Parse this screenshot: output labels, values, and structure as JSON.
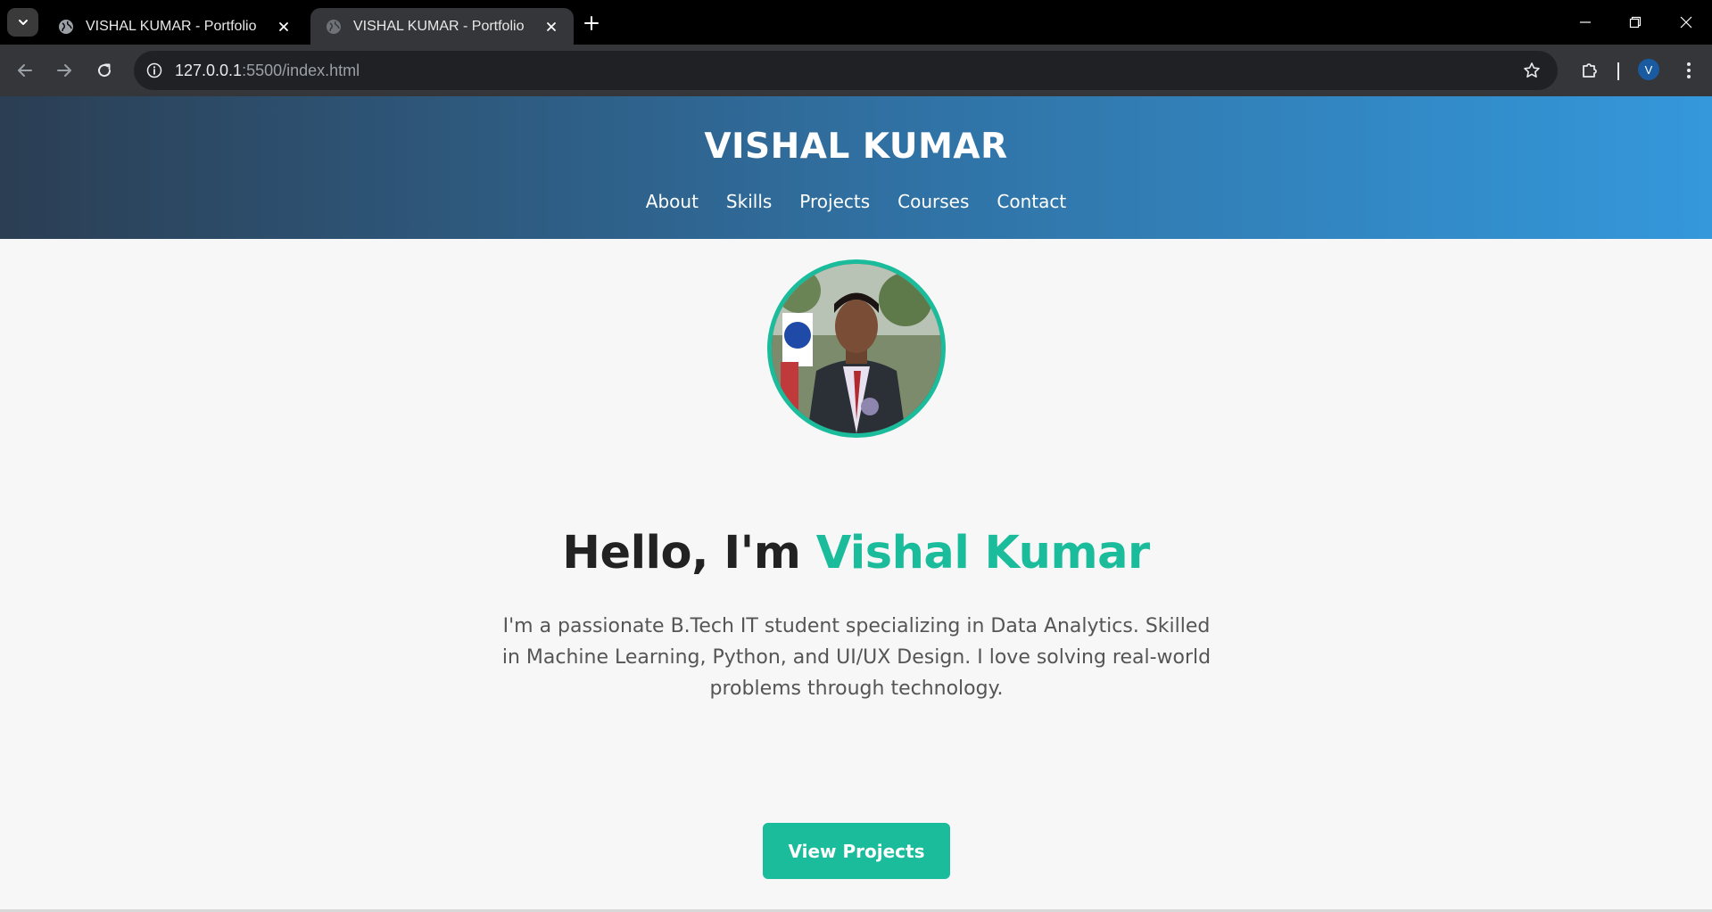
{
  "browser": {
    "tabs": [
      {
        "title": "VISHAL KUMAR - Portfolio",
        "active": false
      },
      {
        "title": "VISHAL KUMAR - Portfolio",
        "active": true
      }
    ],
    "url_host": "127.0.0.1",
    "url_rest": ":5500/index.html",
    "profile_initial": "V"
  },
  "header": {
    "title": "VISHAL KUMAR",
    "nav": [
      "About",
      "Skills",
      "Projects",
      "Courses",
      "Contact"
    ]
  },
  "hero": {
    "greeting": "Hello, I'm ",
    "name": "Vishal Kumar",
    "description": "I'm a passionate B.Tech IT student specializing in Data Analytics. Skilled in Machine Learning, Python, and UI/UX Design. I love solving real-world problems through technology.",
    "button_label": "View Projects"
  },
  "colors": {
    "accent": "#1abc9c",
    "header_gradient_start": "#2b3e53",
    "header_gradient_end": "#3498db"
  }
}
